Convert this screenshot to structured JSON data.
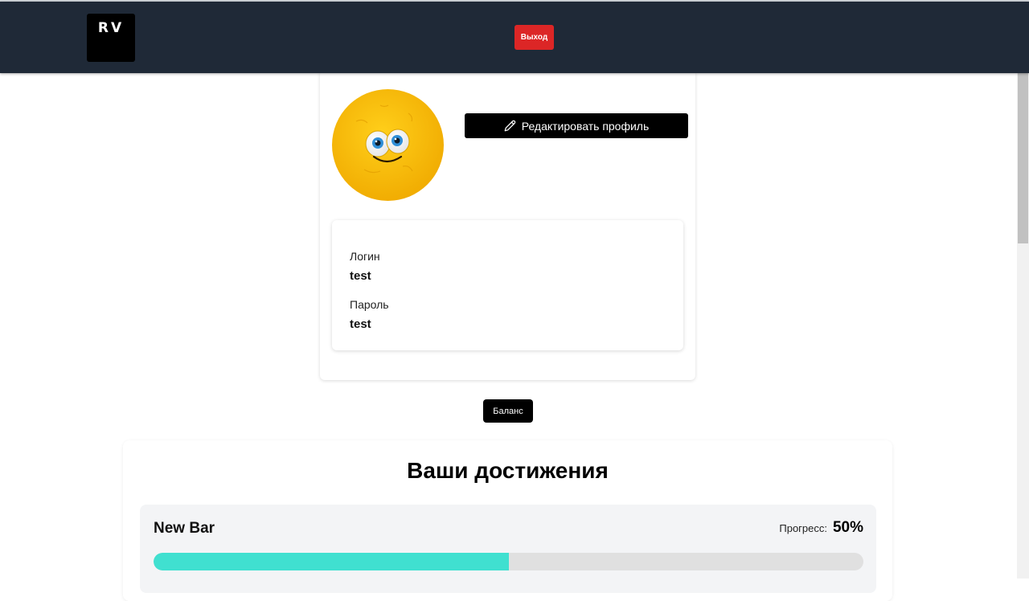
{
  "header": {
    "logo": {
      "mark": "RV",
      "subtitle": "",
      "icon": "rv-logo-icon"
    },
    "logout_label": "Выход"
  },
  "profile": {
    "avatar_icon": "smiley-avatar-icon",
    "edit_label": "Редактировать профиль",
    "edit_icon": "pencil-icon",
    "login_label": "Логин",
    "login_value": "test",
    "password_label": "Пароль",
    "password_value": "test"
  },
  "balance_label": "Баланс",
  "achievements": {
    "title": "Ваши достижения",
    "items": [
      {
        "name": "New Bar",
        "progress_label": "Прогресс:",
        "progress_text": "50%",
        "progress": 0.5
      }
    ]
  },
  "colors": {
    "header_bg": "#1f2937",
    "logout_bg": "#dc2626",
    "progress_fill": "#40e0d0",
    "avatar_bg": "#f5b800"
  }
}
